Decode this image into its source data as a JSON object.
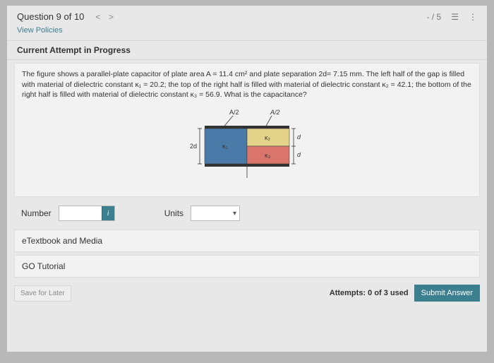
{
  "header": {
    "question_label": "Question 9 of 10",
    "score": "- / 5"
  },
  "policies_link": "View Policies",
  "attempt_status": "Current Attempt in Progress",
  "question": {
    "text_html": "The figure shows a parallel-plate capacitor of plate area A = 11.4 cm² and plate separation 2d= 7.15 mm. The left half of the gap is filled with material of dielectric constant κ₁ = 20.2; the top of the right half is filled with material of dielectric constant κ₂ = 42.1; the bottom of the right half is filled with material of dielectric constant κ₃ = 56.9. What is the capacitance?"
  },
  "diagram": {
    "top_left_label": "A/2",
    "top_right_label": "A/2",
    "left_label": "2d",
    "right_upper_label": "d",
    "right_lower_label": "d",
    "k1": "κ₁",
    "k2": "κ₂",
    "k3": "κ₃"
  },
  "answer": {
    "number_label": "Number",
    "units_label": "Units"
  },
  "links": {
    "etextbook": "eTextbook and Media",
    "tutorial": "GO Tutorial"
  },
  "footer": {
    "save": "Save for Later",
    "attempts": "Attempts: 0 of 3 used",
    "submit": "Submit Answer"
  }
}
